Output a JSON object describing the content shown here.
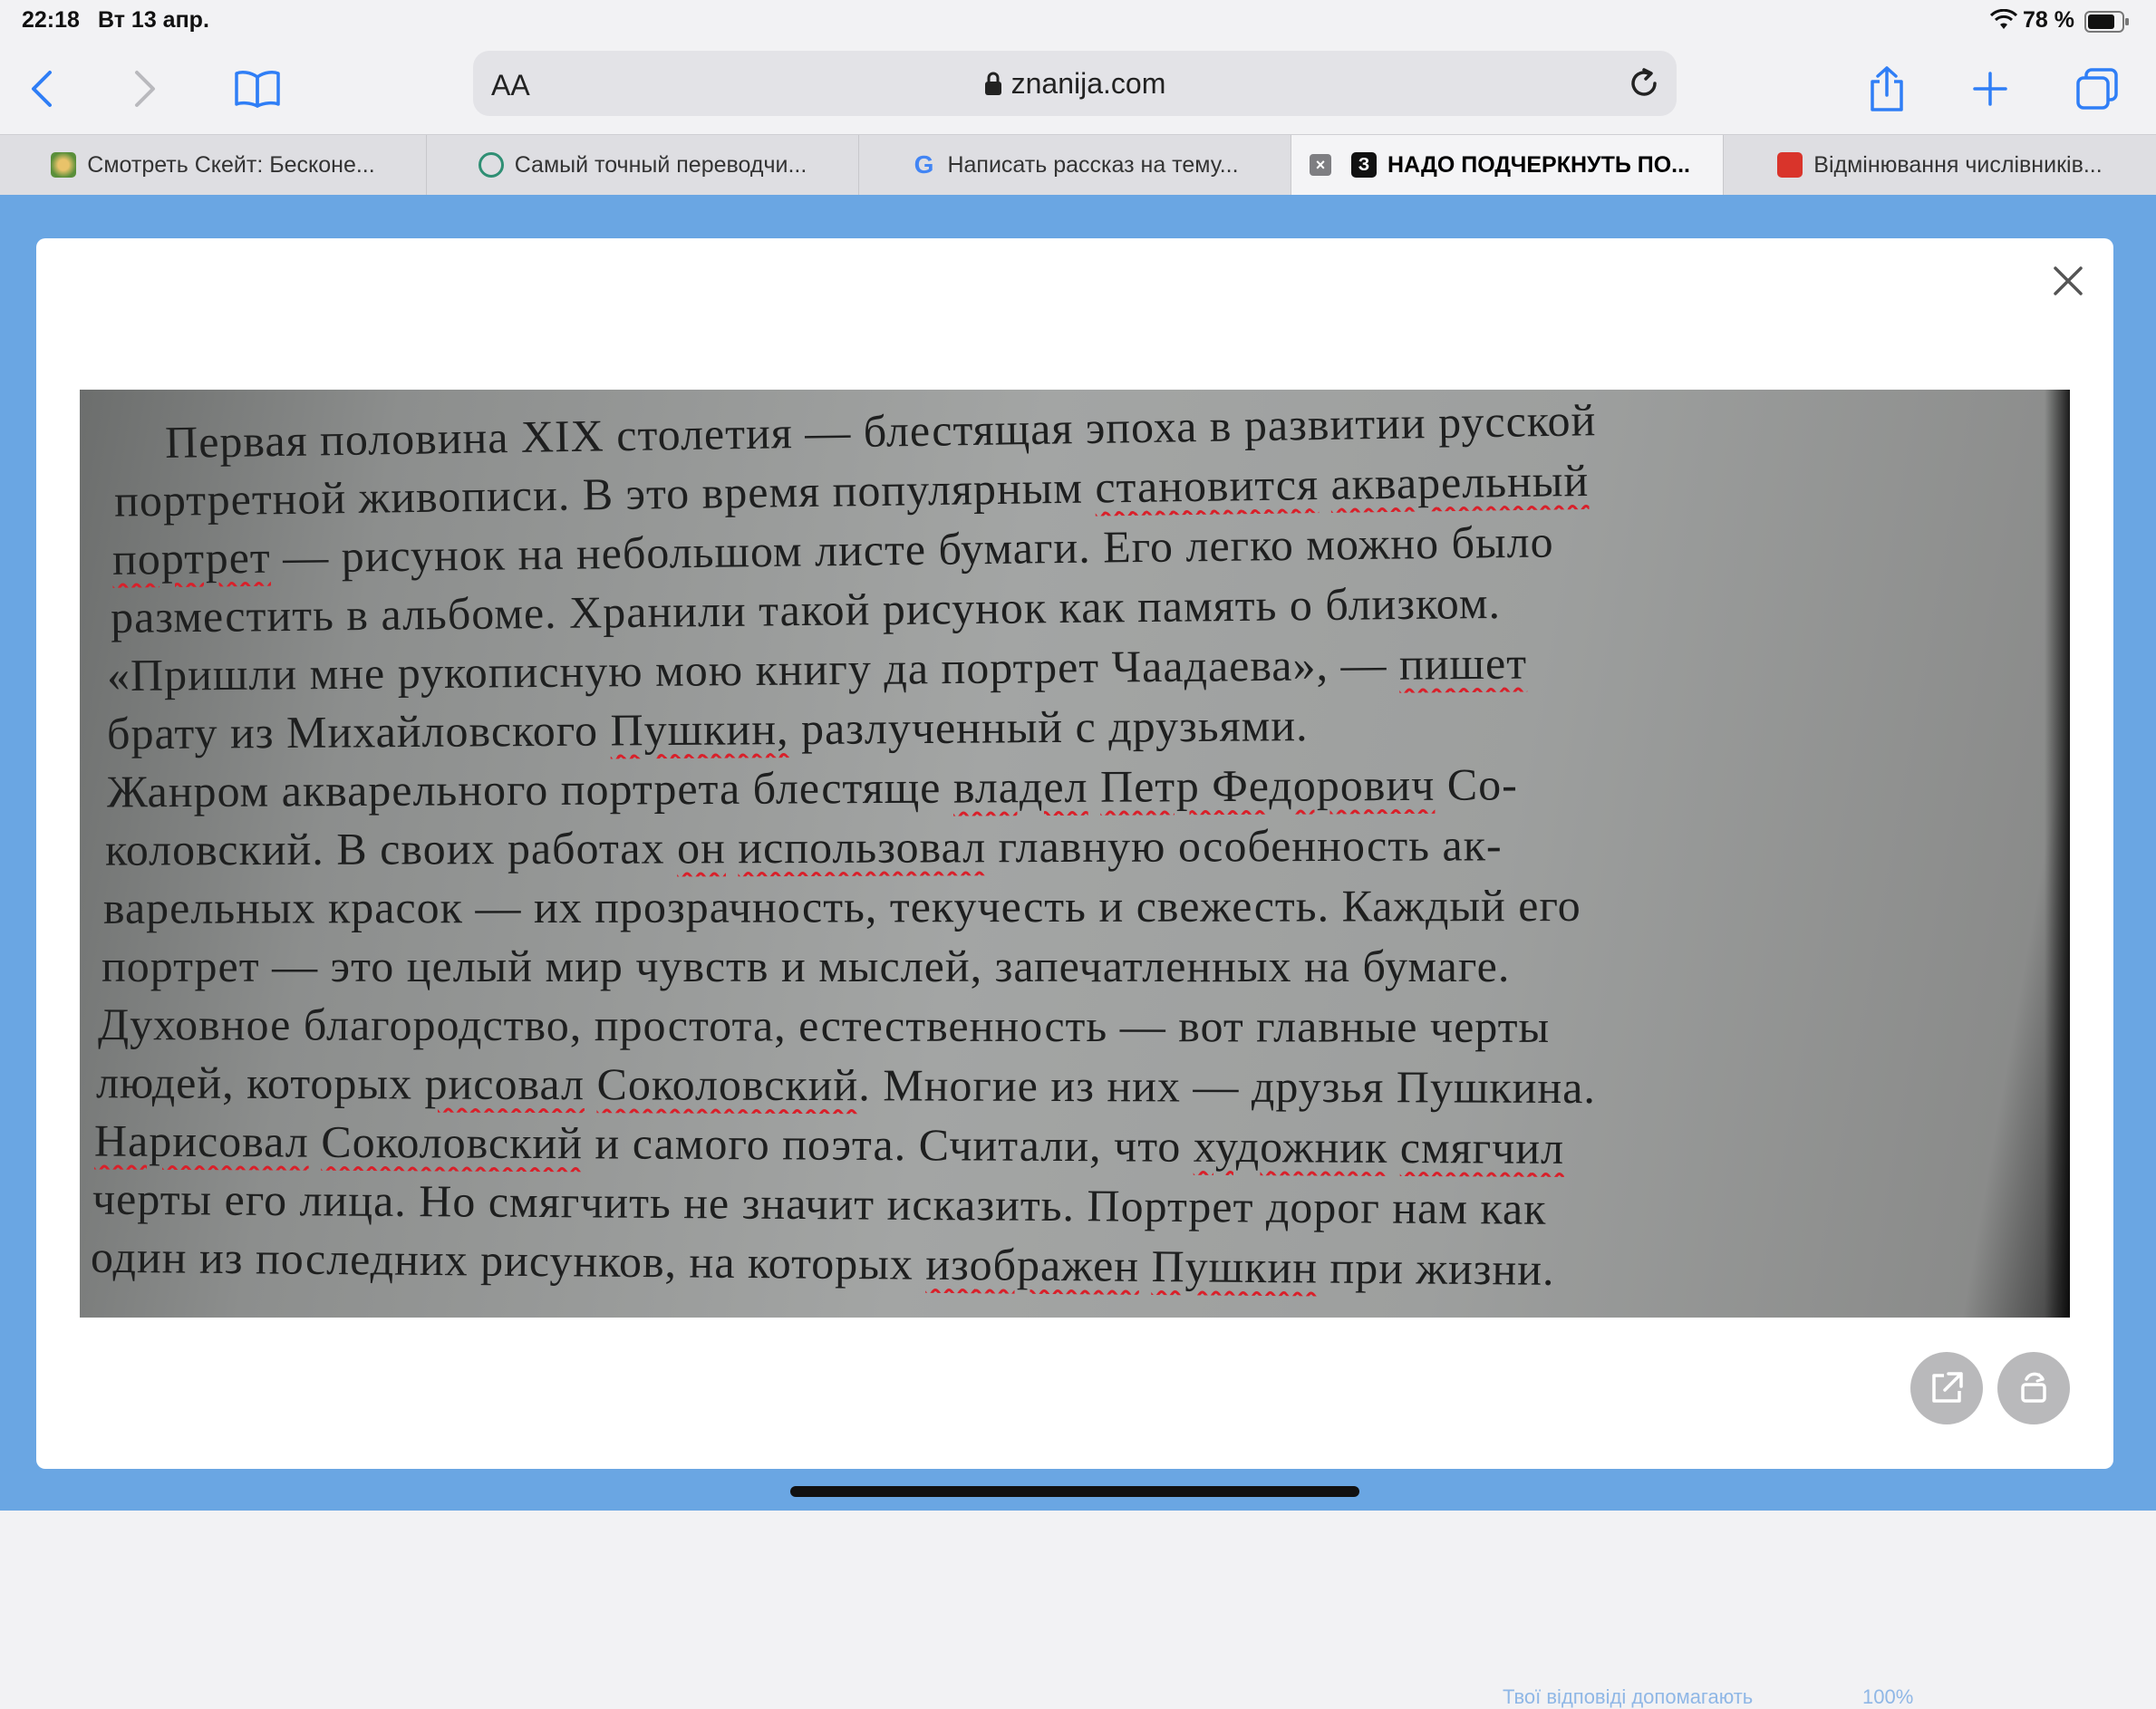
{
  "status": {
    "time": "22:18",
    "date": "Вт 13 апр.",
    "battery": "78 %"
  },
  "toolbar": {
    "aa": "AA",
    "url": "znanija.com"
  },
  "tabs": [
    {
      "label": "Смотреть Скейт: Бесконе...",
      "favicon": "skate-favicon",
      "color": "#5a8f3a"
    },
    {
      "label": "Самый точный переводчи...",
      "favicon": "translator-favicon",
      "color": "#2f8f74"
    },
    {
      "label": "Написать рассказ на тему...",
      "favicon": "google-favicon",
      "color": "#4285f4"
    },
    {
      "label": "НАДО ПОДЧЕРКНУТЬ ПО...",
      "favicon": "znanija-favicon",
      "color": "#111111",
      "active": true
    },
    {
      "label": "Відмінювання числівників...",
      "favicon": "dictionary-favicon",
      "color": "#d9342b"
    }
  ],
  "photo": {
    "lines": [
      [
        {
          "t": "Первая половина XIX столетия — блестящая эпоха в развитии русской"
        }
      ],
      [
        {
          "t": "портретной живописи. В это время популярным "
        },
        {
          "t": "становится",
          "u": true
        },
        {
          "t": " "
        },
        {
          "t": "акварельный",
          "u": true
        }
      ],
      [
        {
          "t": "портрет",
          "u": true
        },
        {
          "t": " — рисунок на небольшом листе бумаги. Его легко можно было"
        }
      ],
      [
        {
          "t": "разместить в альбоме. Хранили такой рисунок как память о близком."
        }
      ],
      [
        {
          "t": "«Пришли мне рукописную мою книгу да портрет Чаадаева», — "
        },
        {
          "t": "пишет",
          "u": true
        }
      ],
      [
        {
          "t": "брату из Михайловского "
        },
        {
          "t": "Пушкин,",
          "u": true
        },
        {
          "t": " разлученный с друзьями."
        }
      ],
      [
        {
          "t": "   Жанром акварельного портрета блестяще "
        },
        {
          "t": "владел",
          "u": true
        },
        {
          "t": " "
        },
        {
          "t": "Петр Федорович",
          "u": true
        },
        {
          "t": " Со-"
        }
      ],
      [
        {
          "t": "коловский. В своих работах "
        },
        {
          "t": "он",
          "u": true
        },
        {
          "t": " "
        },
        {
          "t": "использовал",
          "u": true
        },
        {
          "t": " главную особенность ак-"
        }
      ],
      [
        {
          "t": "варельных красок — их прозрачность, текучесть и свежесть. Каждый его"
        }
      ],
      [
        {
          "t": "портрет — это целый мир чувств и мыслей, запечатленных на бумаге."
        }
      ],
      [
        {
          "t": "Духовное благородство, простота, естественность — вот главные черты"
        }
      ],
      [
        {
          "t": "людей, которых "
        },
        {
          "t": "рисовал",
          "u": true
        },
        {
          "t": " "
        },
        {
          "t": "Соколовский",
          "u": true
        },
        {
          "t": ". Многие из них — друзья Пушкина."
        }
      ],
      [
        {
          "t": "Нарисовал",
          "u": true
        },
        {
          "t": " "
        },
        {
          "t": "Соколовский",
          "u": true
        },
        {
          "t": " и самого поэта. Считали, что "
        },
        {
          "t": "художник",
          "u": true
        },
        {
          "t": " "
        },
        {
          "t": "смягчил",
          "u": true
        }
      ],
      [
        {
          "t": "черты его лица. Но смягчить не значит исказить. Портрет дорог нам как"
        }
      ],
      [
        {
          "t": "один из последних рисунков, на которых "
        },
        {
          "t": "изображен",
          "u": true
        },
        {
          "t": " "
        },
        {
          "t": "Пушкин",
          "u": true
        },
        {
          "t": " при жизни."
        }
      ]
    ]
  },
  "behind": {
    "left": "Твої відповіді допомагають",
    "right": "100%"
  }
}
